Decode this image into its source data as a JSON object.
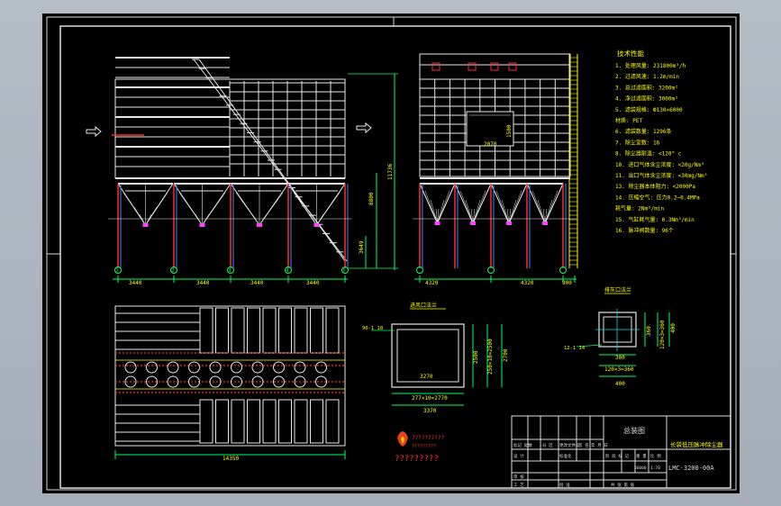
{
  "spec": {
    "title": "技术性能",
    "lines": [
      "1. 处理风量: 231800m³/h",
      "2. 过滤风速: 1.2m/min",
      "3. 总过滤面积: 3200m²",
      "4. 净过滤面积: 3000m²",
      "5. 滤袋规格: Ф130×6000",
      "   材质: PET",
      "6. 滤袋数量: 1296条",
      "7. 除尘室数: 16",
      "8. 除尘器耐温: <120° c",
      "10. 进口气体含尘浓度: <20g/Nm³",
      "11. 出口气体含尘浓度: <30mg/Nm³",
      "13. 除尘器本体阻力: <2000Pa",
      "14. 压缩空气: 压力0.2~0.4MPa",
      "    耗气量: 2Nm³/min",
      "15. 气缸耗气量: 0.3Nm³/min",
      "16. 脉冲阀数量: 96个"
    ]
  },
  "dims": {
    "height_total": "11736",
    "height_hopper": "8800",
    "height_leg": "3649",
    "bays": [
      "3440",
      "3440",
      "3440",
      "3440"
    ],
    "side_bays": [
      "4320",
      "4320",
      "900"
    ],
    "plan_total": "14350",
    "door_w": "2070",
    "door_h": "1500",
    "inlet_w": "3270",
    "inlet_h": "2500",
    "inlet_pitch": "277×10=2770",
    "inlet_side": "250×10=2500",
    "inlet_outer": "2700",
    "inlet_bottom": "3370",
    "inlet_marker": "90-1 18",
    "small_w": "300",
    "small_pitch": "120×3=360",
    "small_h": "360",
    "small_side": "120×3=360",
    "small_outer": "400",
    "small_bottom": "400",
    "small_marker": "12-1 14"
  },
  "grid_labels": [
    "①",
    "②",
    "③",
    "④",
    "⑤"
  ],
  "side_grid_labels": [
    "Ⓐ",
    "Ⓑ",
    "Ⓒ",
    "Ⓓ"
  ],
  "section_titles": {
    "inlet": "进风口法兰",
    "outlet": "排灰口法兰"
  },
  "title_block": {
    "title": "总装图",
    "product": "长袋低压脉冲除尘器",
    "drawing_no": "LMC-3200-00A",
    "scale": "1:70",
    "weight": "56000",
    "hdr1": "标记 处数",
    "hdr2": "分 区",
    "hdr3": "更改文件号",
    "hdr4": "签 名",
    "hdr5": "年 月 日",
    "row2a": "设 计",
    "row2b": "标准化",
    "row2c": "阶 段 标 记",
    "row2d": "重 量",
    "row2e": "比 例",
    "row3a": "审 核",
    "row4a": "工 艺",
    "row4b": "批 准",
    "row4c": "共 张 第 张"
  },
  "logo": {
    "text1": "??????????",
    "text2": "?????????",
    "caption": "?????????"
  }
}
